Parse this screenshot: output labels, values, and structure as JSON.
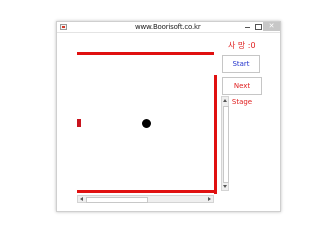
{
  "window": {
    "title": "www.Boorisoft.co.kr",
    "icon": "app-icon",
    "controls": {
      "minimize_icon": "minimize-icon",
      "maximize_icon": "maximize-icon",
      "close_label": "✕"
    }
  },
  "status": {
    "death_text": "사 망 :0"
  },
  "buttons": {
    "start_label": "Start",
    "next_stage_label": "Next Stage"
  },
  "game": {
    "wall_color": "#e01010",
    "paddle_color": "#c8141e",
    "ball_color": "#000000"
  },
  "colors": {
    "start_text": "#2233cc",
    "next_stage_text": "#e02020",
    "death_text": "#e02020"
  }
}
